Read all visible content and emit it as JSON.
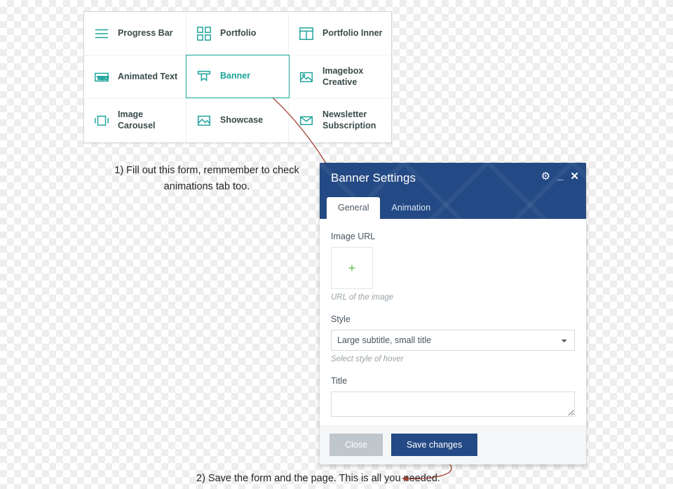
{
  "picker": {
    "items": [
      {
        "label": "Progress Bar",
        "icon": "progress"
      },
      {
        "label": "Portfolio",
        "icon": "portfolio"
      },
      {
        "label": "Portfolio Inner",
        "icon": "portfolio-inner"
      },
      {
        "label": "Animated Text",
        "icon": "animated-text"
      },
      {
        "label": "Banner",
        "icon": "banner",
        "selected": true
      },
      {
        "label": "Imagebox Creative",
        "icon": "imagebox"
      },
      {
        "label": "Image Carousel",
        "icon": "carousel"
      },
      {
        "label": "Showcase",
        "icon": "showcase"
      },
      {
        "label": "Newsletter Subscription",
        "icon": "newsletter"
      }
    ]
  },
  "captions": {
    "step1": "1) Fill out this form, remmember to  check animations tab too.",
    "step2": "2) Save the form and the page. This is all you needed."
  },
  "modal": {
    "title": "Banner Settings",
    "tabs": {
      "general": "General",
      "animation": "Animation"
    },
    "fields": {
      "image_url": {
        "label": "Image URL",
        "helper": "URL of the image",
        "plus": "+"
      },
      "style": {
        "label": "Style",
        "value": "Large subtitle, small title",
        "helper": "Select style of hover"
      },
      "title": {
        "label": "Title"
      }
    },
    "buttons": {
      "close": "Close",
      "save": "Save changes"
    }
  },
  "colors": {
    "accent": "#1aa39a",
    "modal_head": "#244a85"
  }
}
